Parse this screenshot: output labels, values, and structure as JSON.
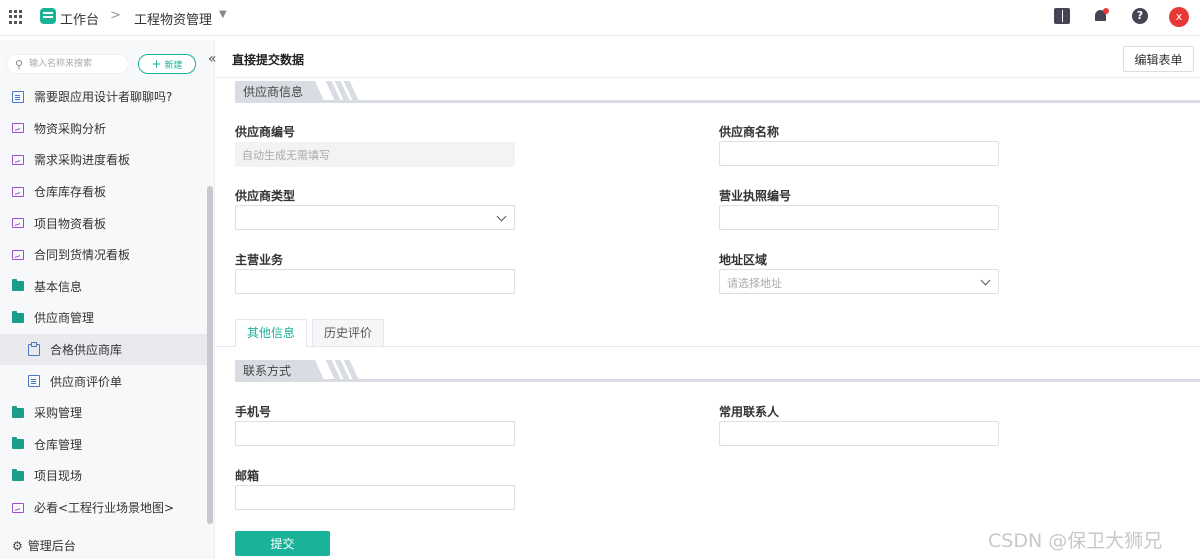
{
  "topbar": {
    "workbench": "工作台",
    "separator": ">",
    "app_name": "工程物资管理",
    "avatar_letter": "x"
  },
  "sidebar": {
    "search_placeholder": "输入名称来搜索",
    "new_button": "新建",
    "items": [
      {
        "label": "需要跟应用设计者聊聊吗?",
        "icon": "doc"
      },
      {
        "label": "物资采购分析",
        "icon": "board"
      },
      {
        "label": "需求采购进度看板",
        "icon": "board"
      },
      {
        "label": "仓库库存看板",
        "icon": "board"
      },
      {
        "label": "项目物资看板",
        "icon": "board"
      },
      {
        "label": "合同到货情况看板",
        "icon": "board"
      },
      {
        "label": "基本信息",
        "icon": "folder"
      },
      {
        "label": "供应商管理",
        "icon": "folder"
      },
      {
        "label": "合格供应商库",
        "icon": "clip"
      },
      {
        "label": "供应商评价单",
        "icon": "doc"
      },
      {
        "label": "采购管理",
        "icon": "folder"
      },
      {
        "label": "仓库管理",
        "icon": "folder"
      },
      {
        "label": "项目现场",
        "icon": "folder"
      },
      {
        "label": "必看<工程行业场景地图>",
        "icon": "board"
      }
    ],
    "admin": "管理后台"
  },
  "main": {
    "title": "直接提交数据",
    "edit_button": "编辑表单",
    "section_supplier": "供应商信息",
    "fields": {
      "supplier_no_label": "供应商编号",
      "supplier_no_value": "自动生成无需填写",
      "supplier_name_label": "供应商名称",
      "supplier_type_label": "供应商类型",
      "license_no_label": "营业执照编号",
      "main_business_label": "主营业务",
      "address_label": "地址区域",
      "address_placeholder": "请选择地址"
    },
    "tabs": [
      "其他信息",
      "历史评价"
    ],
    "section_contact": "联系方式",
    "contact": {
      "phone_label": "手机号",
      "contact_person_label": "常用联系人",
      "email_label": "邮箱"
    },
    "submit": "提交"
  },
  "watermark": "CSDN @保卫大狮兄",
  "colors": {
    "accent": "#1bb29a",
    "avatar": "#e53935"
  }
}
